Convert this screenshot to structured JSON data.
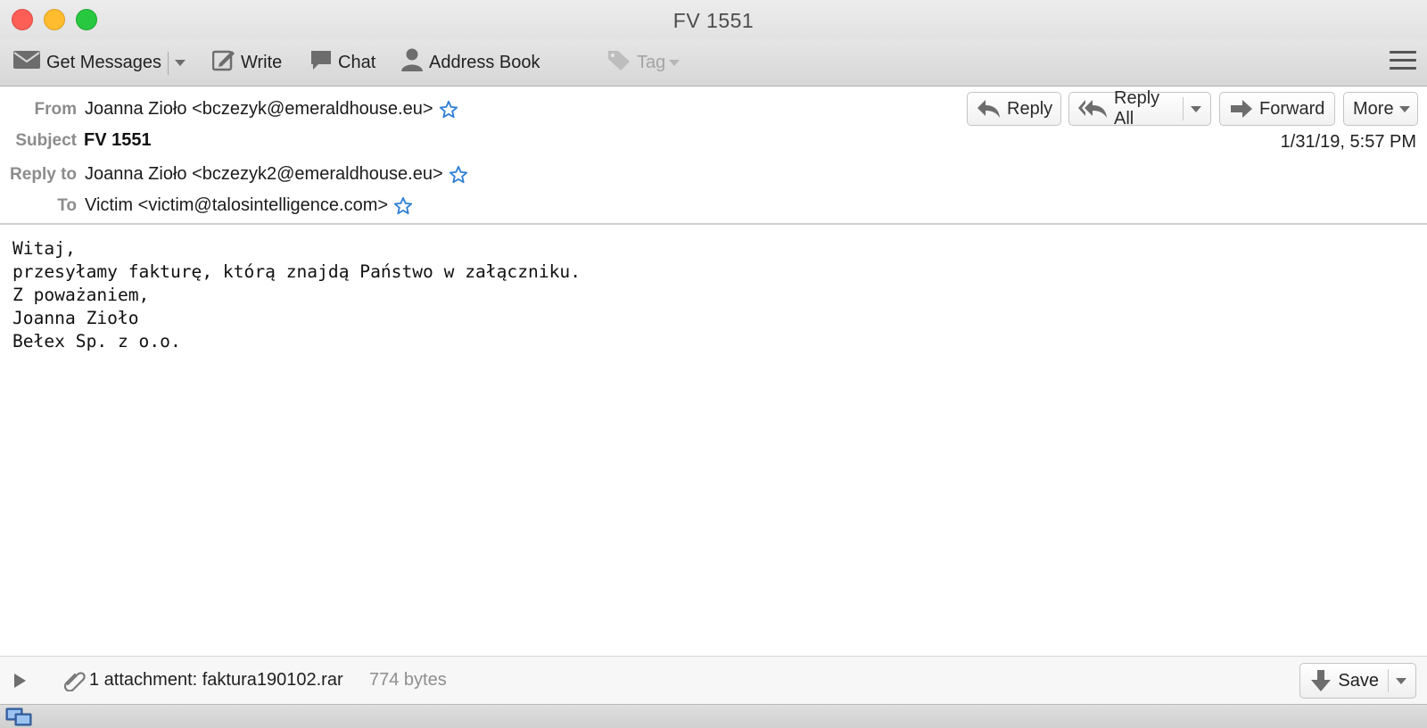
{
  "window": {
    "title": "FV 1551"
  },
  "toolbar": {
    "get_messages": "Get Messages",
    "write": "Write",
    "chat": "Chat",
    "address_book": "Address Book",
    "tag": "Tag"
  },
  "header": {
    "labels": {
      "from": "From",
      "subject": "Subject",
      "reply_to": "Reply to",
      "to": "To"
    },
    "from": "Joanna Zioło <bczezyk@emeraldhouse.eu>",
    "subject": "FV 1551",
    "reply_to": "Joanna Zioło <bczezyk2@emeraldhouse.eu>",
    "to": "Victim <victim@talosintelligence.com>",
    "date": "1/31/19, 5:57 PM",
    "buttons": {
      "reply": "Reply",
      "reply_all": "Reply All",
      "forward": "Forward",
      "more": "More"
    }
  },
  "body": {
    "lines": [
      "Witaj,",
      "przesyłamy fakturę, którą znajdą Państwo w załączniku.",
      "Z poważaniem,",
      "Joanna Zioło",
      "Bełex Sp. z o.o."
    ]
  },
  "attachment": {
    "summary": "1 attachment: faktura190102.rar",
    "size": "774 bytes",
    "save_label": "Save"
  },
  "colors": {
    "star": "#2f7fd6",
    "close": "#fd5f57",
    "minimize": "#febc2e",
    "maximize": "#28c840"
  }
}
